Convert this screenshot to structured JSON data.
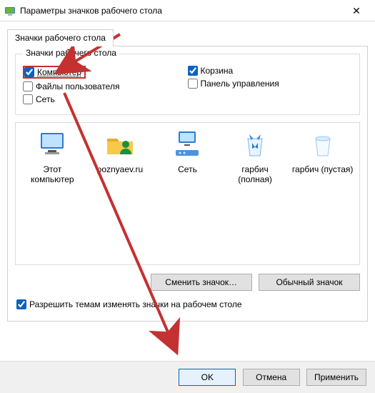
{
  "window": {
    "title": "Параметры значков рабочего стола"
  },
  "tab": {
    "label": "Значки рабочего стола"
  },
  "group": {
    "legend": "Значки рабочего стола",
    "cb": {
      "computer": "Компьютер",
      "recycle_bin": "Корзина",
      "user_files": "Файлы пользователя",
      "control_panel": "Панель управления",
      "network": "Сеть"
    }
  },
  "preview": {
    "this_pc": "Этот компьютер",
    "user": "poznyaev.ru",
    "network": "Сеть",
    "bin_full": "гарбич (полная)",
    "bin_empty": "гарбич (пустая)"
  },
  "buttons": {
    "change_icon": "Сменить значок…",
    "default_icon": "Обычный значок"
  },
  "allow_themes": "Разрешить темам изменять значки на рабочем столе",
  "footer": {
    "ok": "OK",
    "cancel": "Отмена",
    "apply": "Применить"
  }
}
